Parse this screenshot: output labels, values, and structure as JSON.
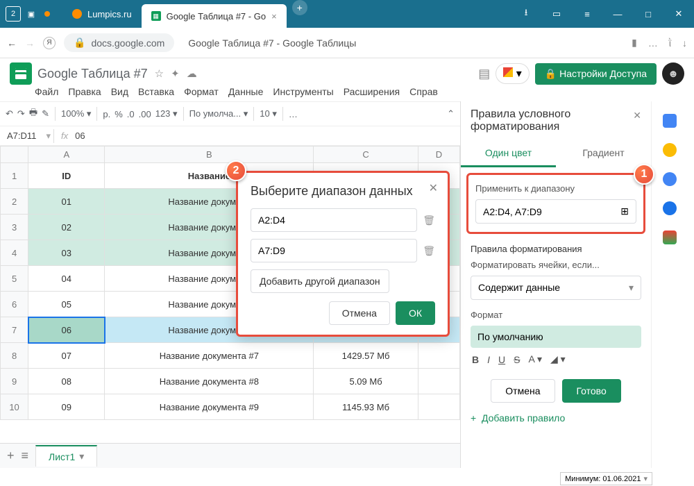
{
  "titlebar": {
    "home_num": "2",
    "tab1": "Lumpics.ru",
    "tab2": "Google Таблица #7 - Go",
    "tab2_x": "×"
  },
  "addr": {
    "back": "←",
    "fwd": "→",
    "domain": "docs.google.com",
    "pagetitle": "Google Таблица #7 - Google Таблицы"
  },
  "doc": {
    "title": "Google Таблица #7",
    "share": "Настройки Доступа"
  },
  "menu": [
    "Файл",
    "Правка",
    "Вид",
    "Вставка",
    "Формат",
    "Данные",
    "Инструменты",
    "Расширения",
    "Справ"
  ],
  "toolbar": {
    "zoom": "100%",
    "cur": "p.",
    "pct": "%",
    "dd": ".0",
    "di": ".00",
    "num": "123",
    "font": "По умолча...",
    "size": "10"
  },
  "namebox": {
    "ref": "A7:D11",
    "fx": "fx",
    "val": "06"
  },
  "columns": [
    "",
    "A",
    "B",
    "C",
    "D"
  ],
  "headers": {
    "id": "ID",
    "name": "Название"
  },
  "rows": [
    {
      "n": "1",
      "id": "ID",
      "name": "Название",
      "size": "",
      "hl": false,
      "hdr": true
    },
    {
      "n": "2",
      "id": "01",
      "name": "Название документ",
      "size": "",
      "hl": true
    },
    {
      "n": "3",
      "id": "02",
      "name": "Название документ",
      "size": "",
      "hl": true
    },
    {
      "n": "4",
      "id": "03",
      "name": "Название документ",
      "size": "",
      "hl": true
    },
    {
      "n": "5",
      "id": "04",
      "name": "Название документ",
      "size": "",
      "hl": false
    },
    {
      "n": "6",
      "id": "05",
      "name": "Название документ",
      "size": "",
      "hl": false
    },
    {
      "n": "7",
      "id": "06",
      "name": "Название документ",
      "size": "",
      "hl": true,
      "sel": true
    },
    {
      "n": "8",
      "id": "07",
      "name": "Название документа #7",
      "size": "1429.57 Мб",
      "hl": false
    },
    {
      "n": "9",
      "id": "08",
      "name": "Название документа #8",
      "size": "5.09 Мб",
      "hl": false
    },
    {
      "n": "10",
      "id": "09",
      "name": "Название документа #9",
      "size": "1145.93 Мб",
      "hl": false
    }
  ],
  "dialog": {
    "title": "Выберите диапазон данных",
    "r1": "A2:D4",
    "r2": "A7:D9",
    "add": "Добавить другой диапазон",
    "cancel": "Отмена",
    "ok": "ОК"
  },
  "panel": {
    "title": "Правила условного форматирования",
    "tab1": "Один цвет",
    "tab2": "Градиент",
    "apply_lbl": "Применить к диапазону",
    "range": "A2:D4, A7:D9",
    "rules_lbl": "Правила форматирования",
    "cond_lbl": "Форматировать ячейки, если...",
    "cond_val": "Содержит данные",
    "fmt_lbl": "Формат",
    "fmt_prev": "По умолчанию",
    "cancel": "Отмена",
    "done": "Готово",
    "addrule": "Добавить правило"
  },
  "sheettab": "Лист1",
  "status": "Минимум: 01.06.2021",
  "badges": {
    "b1": "1",
    "b2": "2"
  }
}
